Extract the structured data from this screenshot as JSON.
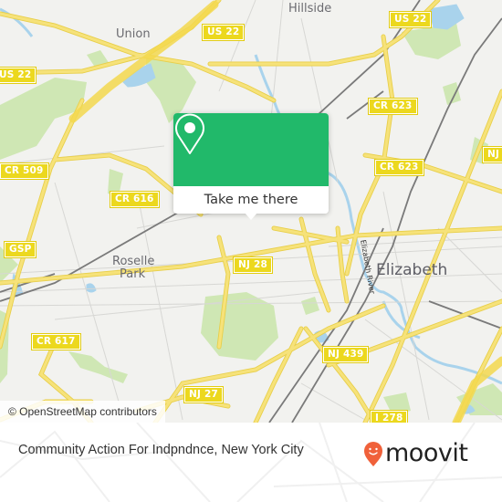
{
  "map": {
    "attribution": "© OpenStreetMap contributors",
    "colors": {
      "background": "#f2f2ef",
      "park": "#cfe7b4",
      "water": "#a9d3ec",
      "major_road": "#f6e27a",
      "minor_road": "#d7d7d4",
      "rail": "#7a7a7a",
      "shield": "#ecd81e"
    },
    "places": [
      {
        "name": "Union"
      },
      {
        "name": "Hillside"
      },
      {
        "name": "Roselle"
      },
      {
        "name": "Park"
      },
      {
        "name": "Elizabeth"
      }
    ],
    "river_label": "Elizabeth River",
    "route_shields": [
      {
        "label": "US 22"
      },
      {
        "label": "US 22"
      },
      {
        "label": "US 22"
      },
      {
        "label": "CR 623"
      },
      {
        "label": "CR 623"
      },
      {
        "label": "CR 509"
      },
      {
        "label": "CR 616"
      },
      {
        "label": "GSP"
      },
      {
        "label": "NJ 28"
      },
      {
        "label": "CR 617"
      },
      {
        "label": "NJ 27"
      },
      {
        "label": "NJ 439"
      },
      {
        "label": "I 278"
      },
      {
        "label": "NJ"
      }
    ]
  },
  "popup": {
    "icon": "map-pin-icon",
    "button_label": "Take me there",
    "accent_color": "#21b96a"
  },
  "footer": {
    "title": "Community Action For Indpndnce, New York City",
    "brand": "moovit",
    "brand_color": "#f0613a"
  }
}
